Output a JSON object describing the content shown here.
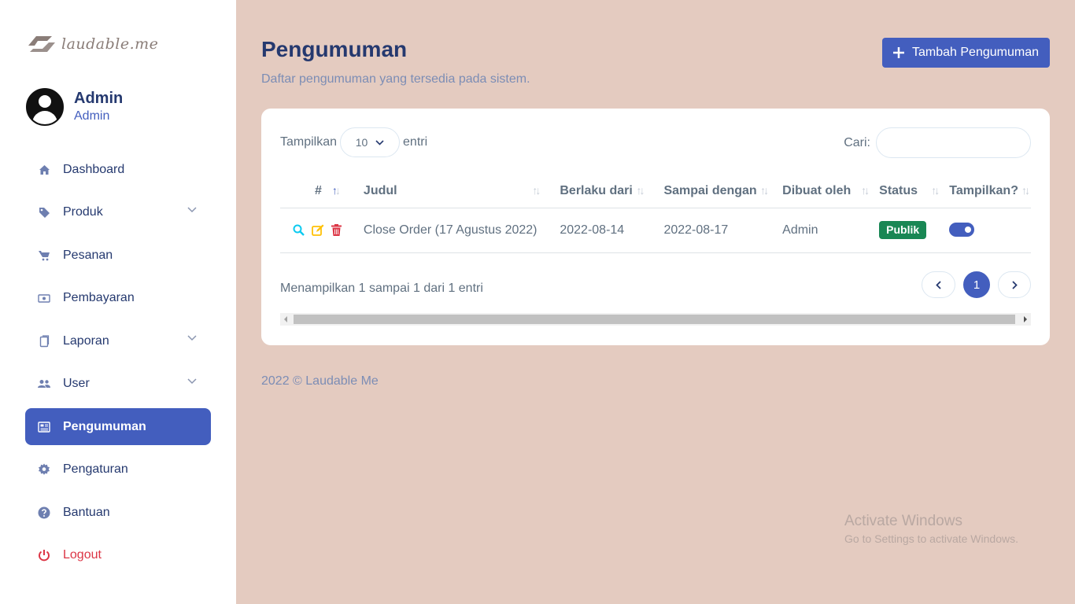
{
  "brand": {
    "logo_text": "laudable.me"
  },
  "user": {
    "name": "Admin",
    "role": "Admin"
  },
  "menu": [
    {
      "label": "Dashboard",
      "icon": "home-icon",
      "has_submenu": false
    },
    {
      "label": "Produk",
      "icon": "tag-icon",
      "has_submenu": true
    },
    {
      "label": "Pesanan",
      "icon": "cart-icon",
      "has_submenu": false
    },
    {
      "label": "Pembayaran",
      "icon": "cash-icon",
      "has_submenu": false
    },
    {
      "label": "Laporan",
      "icon": "document-icon",
      "has_submenu": true
    },
    {
      "label": "User",
      "icon": "people-icon",
      "has_submenu": true
    },
    {
      "label": "Pengumuman",
      "icon": "newspaper-icon",
      "has_submenu": false,
      "active": true
    },
    {
      "label": "Pengaturan",
      "icon": "gear-icon",
      "has_submenu": false
    },
    {
      "label": "Bantuan",
      "icon": "question-icon",
      "has_submenu": false
    },
    {
      "label": "Logout",
      "icon": "power-icon",
      "has_submenu": false
    }
  ],
  "page": {
    "title": "Pengumuman",
    "subtitle": "Daftar pengumuman yang tersedia pada sistem.",
    "add_button": "Tambah Pengumuman"
  },
  "table_controls": {
    "show_label": "Tampilkan",
    "show_value": "10",
    "entries_label": "entri",
    "search_label": "Cari:",
    "search_value": ""
  },
  "table": {
    "columns": [
      "#",
      "Judul",
      "Berlaku dari",
      "Sampai dengan",
      "Dibuat oleh",
      "Status",
      "Tampilkan?"
    ],
    "rows": [
      {
        "title": "Close Order (17 Agustus 2022)",
        "valid_from": "2022-08-14",
        "valid_to": "2022-08-17",
        "created_by": "Admin",
        "status": "Publik",
        "shown": true
      }
    ]
  },
  "pagination": {
    "info": "Menampilkan 1 sampai 1 dari 1 entri",
    "current_page": "1"
  },
  "footer": {
    "text": "2022 © Laudable Me"
  },
  "watermark": {
    "title": "Activate Windows",
    "subtitle": "Go to Settings to activate Windows."
  },
  "colors": {
    "primary": "#435ebe",
    "background": "#e4cbc0",
    "badge_success": "#198754",
    "danger": "#dc3545",
    "warning": "#ffc107",
    "info": "#0dcaf0"
  }
}
